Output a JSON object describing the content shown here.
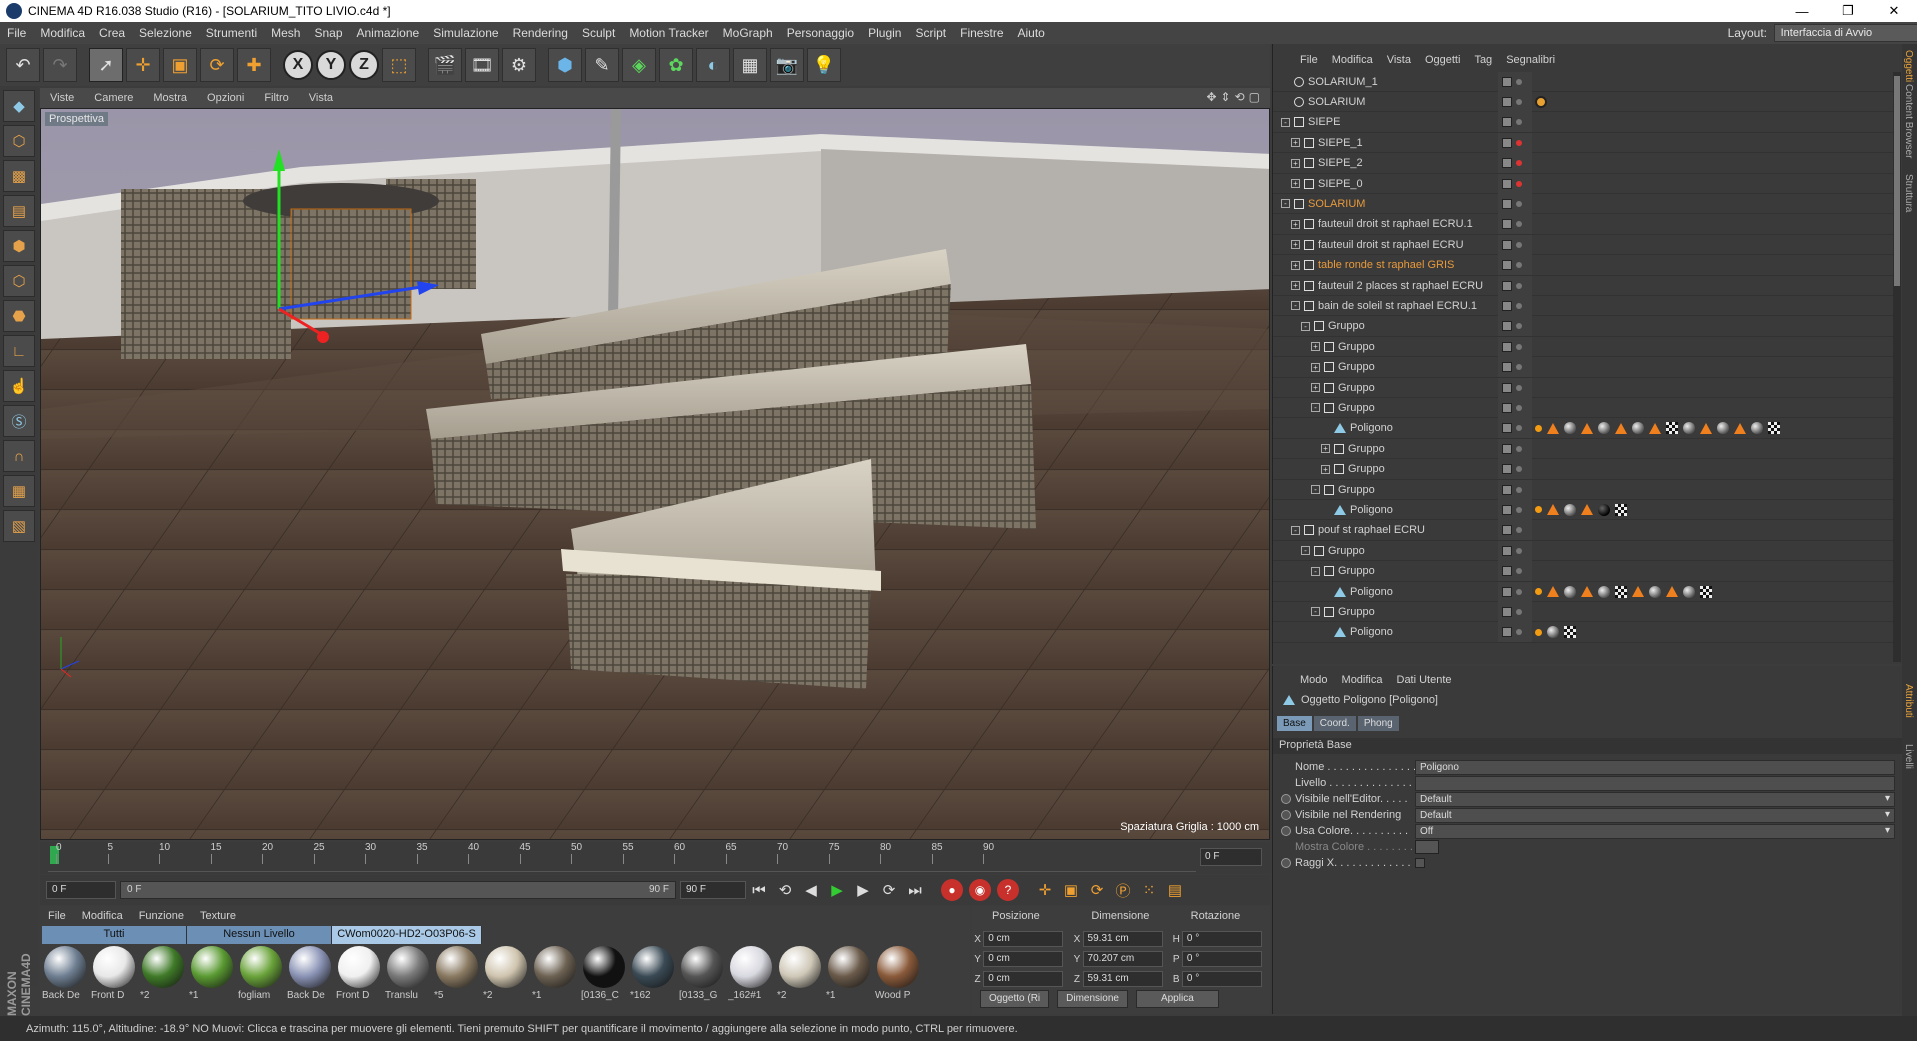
{
  "window": {
    "title": "CINEMA 4D R16.038 Studio (R16) - [SOLARIUM_TITO LIVIO.c4d *]"
  },
  "menu": {
    "items": [
      "File",
      "Modifica",
      "Crea",
      "Selezione",
      "Strumenti",
      "Mesh",
      "Snap",
      "Animazione",
      "Simulazione",
      "Rendering",
      "Sculpt",
      "Motion Tracker",
      "MoGraph",
      "Personaggio",
      "Plugin",
      "Script",
      "Finestre",
      "Aiuto"
    ],
    "layout_label": "Layout:",
    "layout_value": "Interfaccia di Avvio"
  },
  "viewport": {
    "menu": [
      "Viste",
      "Camere",
      "Mostra",
      "Opzioni",
      "Filtro",
      "Vista"
    ],
    "label": "Prospettiva",
    "grid_spacing": "Spaziatura Griglia : 1000 cm"
  },
  "timeline": {
    "ticks": [
      "0",
      "5",
      "10",
      "15",
      "20",
      "25",
      "30",
      "35",
      "40",
      "45",
      "50",
      "55",
      "60",
      "65",
      "70",
      "75",
      "80",
      "85",
      "90"
    ],
    "frame_end_field": "0 F",
    "start_field": "0 F",
    "range_start": "0 F",
    "range_end": "90 F",
    "end_field": "90 F"
  },
  "materials": {
    "menu": [
      "File",
      "Modifica",
      "Funzione",
      "Texture"
    ],
    "tabs": [
      "Tutti",
      "Nessun Livello",
      "CWom0020-HD2-O03P06-S"
    ],
    "items": [
      {
        "name": "Back De",
        "color": "#6f7f92"
      },
      {
        "name": "Front D",
        "color": "#e8e8e8"
      },
      {
        "name": "*2",
        "color": "#3f7a28"
      },
      {
        "name": "*1",
        "color": "#5a9a32"
      },
      {
        "name": "fogliam",
        "color": "#6aa33a"
      },
      {
        "name": "Back De",
        "color": "#8a93b5"
      },
      {
        "name": "Front D",
        "color": "#f0f0f0"
      },
      {
        "name": "Translu",
        "color": "#7a7a7a"
      },
      {
        "name": "*5",
        "color": "#8a7a62"
      },
      {
        "name": "*2",
        "color": "#cfc4ae"
      },
      {
        "name": "*1",
        "color": "#6d6253"
      },
      {
        "name": "[0136_C",
        "color": "#111111"
      },
      {
        "name": "*162",
        "color": "#3a4a55"
      },
      {
        "name": "[0133_G",
        "color": "#555555"
      },
      {
        "name": "_162#1",
        "color": "#d8d8e0"
      },
      {
        "name": "*2",
        "color": "#cfc8b8"
      },
      {
        "name": "*1",
        "color": "#6a5a4a"
      },
      {
        "name": "Wood P",
        "color": "#8a5a3a"
      }
    ]
  },
  "coords": {
    "headers": [
      "Posizione",
      "Dimensione",
      "Rotazione"
    ],
    "rows": [
      {
        "axis": "X",
        "pos": "0 cm",
        "dim_axis": "X",
        "dim": "59.31 cm",
        "rot_axis": "H",
        "rot": "0 °"
      },
      {
        "axis": "Y",
        "pos": "0 cm",
        "dim_axis": "Y",
        "dim": "70.207 cm",
        "rot_axis": "P",
        "rot": "0 °"
      },
      {
        "axis": "Z",
        "pos": "0 cm",
        "dim_axis": "Z",
        "dim": "59.31 cm",
        "rot_axis": "B",
        "rot": "0 °"
      }
    ],
    "btn_mode": "Oggetto (Ri",
    "btn_dim": "Dimensione",
    "btn_apply": "Applica"
  },
  "objects": {
    "menu": [
      "File",
      "Modifica",
      "Vista",
      "Oggetti",
      "Tag",
      "Segnalibri"
    ],
    "rows": [
      {
        "name": "SOLARIUM_1",
        "indent": 0,
        "type": "light",
        "exp": "",
        "color": "normal",
        "dot": "grey",
        "tags": []
      },
      {
        "name": "SOLARIUM",
        "indent": 0,
        "type": "light",
        "exp": "",
        "color": "normal",
        "dot": "grey",
        "tags": [
          "forbid"
        ]
      },
      {
        "name": "SIEPE",
        "indent": 0,
        "type": "null",
        "exp": "-",
        "color": "normal",
        "dot": "grey",
        "tags": []
      },
      {
        "name": "SIEPE_1",
        "indent": 1,
        "type": "null",
        "exp": "+",
        "color": "normal",
        "dot": "red",
        "tags": []
      },
      {
        "name": "SIEPE_2",
        "indent": 1,
        "type": "null",
        "exp": "+",
        "color": "normal",
        "dot": "red",
        "tags": []
      },
      {
        "name": "SIEPE_0",
        "indent": 1,
        "type": "null",
        "exp": "+",
        "color": "normal",
        "dot": "red",
        "tags": []
      },
      {
        "name": "SOLARIUM",
        "indent": 0,
        "type": "null",
        "exp": "-",
        "color": "orange",
        "dot": "grey",
        "tags": []
      },
      {
        "name": "fauteuil droit st raphael ECRU.1",
        "indent": 1,
        "type": "null",
        "exp": "+",
        "color": "normal",
        "dot": "grey",
        "tags": []
      },
      {
        "name": "fauteuil droit st raphael ECRU",
        "indent": 1,
        "type": "null",
        "exp": "+",
        "color": "normal",
        "dot": "grey",
        "tags": []
      },
      {
        "name": "table ronde st raphael GRIS",
        "indent": 1,
        "type": "null",
        "exp": "+",
        "color": "orange",
        "dot": "grey",
        "tags": []
      },
      {
        "name": "fauteuil 2 places st raphael ECRU",
        "indent": 1,
        "type": "null",
        "exp": "+",
        "color": "normal",
        "dot": "grey",
        "tags": []
      },
      {
        "name": "bain de soleil st raphael ECRU.1",
        "indent": 1,
        "type": "null",
        "exp": "-",
        "color": "normal",
        "dot": "grey",
        "tags": []
      },
      {
        "name": "Gruppo",
        "indent": 2,
        "type": "null",
        "exp": "-",
        "color": "normal",
        "dot": "grey",
        "tags": []
      },
      {
        "name": "Gruppo",
        "indent": 3,
        "type": "null",
        "exp": "+",
        "color": "normal",
        "dot": "grey",
        "tags": []
      },
      {
        "name": "Gruppo",
        "indent": 3,
        "type": "null",
        "exp": "+",
        "color": "normal",
        "dot": "grey",
        "tags": []
      },
      {
        "name": "Gruppo",
        "indent": 3,
        "type": "null",
        "exp": "+",
        "color": "normal",
        "dot": "grey",
        "tags": []
      },
      {
        "name": "Gruppo",
        "indent": 3,
        "type": "null",
        "exp": "-",
        "color": "normal",
        "dot": "grey",
        "tags": []
      },
      {
        "name": "Poligono",
        "indent": 4,
        "type": "poly",
        "exp": "",
        "color": "normal",
        "dot": "grey",
        "tags": [
          "dot",
          "tri",
          "sph",
          "tri",
          "sph",
          "tri",
          "sph",
          "tri",
          "chk",
          "sph",
          "tri",
          "sph",
          "tri",
          "sph",
          "chk"
        ]
      },
      {
        "name": "Gruppo",
        "indent": 4,
        "type": "null",
        "exp": "+",
        "color": "normal",
        "dot": "grey",
        "tags": []
      },
      {
        "name": "Gruppo",
        "indent": 4,
        "type": "null",
        "exp": "+",
        "color": "normal",
        "dot": "grey",
        "tags": []
      },
      {
        "name": "Gruppo",
        "indent": 3,
        "type": "null",
        "exp": "-",
        "color": "normal",
        "dot": "grey",
        "tags": []
      },
      {
        "name": "Poligono",
        "indent": 4,
        "type": "poly",
        "exp": "",
        "color": "normal",
        "dot": "grey",
        "tags": [
          "dot",
          "tri",
          "sph",
          "tri",
          "blk",
          "chk"
        ]
      },
      {
        "name": "pouf st raphael ECRU",
        "indent": 1,
        "type": "null",
        "exp": "-",
        "color": "normal",
        "dot": "grey",
        "tags": []
      },
      {
        "name": "Gruppo",
        "indent": 2,
        "type": "null",
        "exp": "-",
        "color": "normal",
        "dot": "grey",
        "tags": []
      },
      {
        "name": "Gruppo",
        "indent": 3,
        "type": "null",
        "exp": "-",
        "color": "normal",
        "dot": "grey",
        "tags": []
      },
      {
        "name": "Poligono",
        "indent": 4,
        "type": "poly",
        "exp": "",
        "color": "normal",
        "dot": "grey",
        "tags": [
          "dot",
          "tri",
          "sph",
          "tri",
          "sph",
          "chk",
          "tri",
          "sph",
          "tri",
          "sph",
          "chk"
        ]
      },
      {
        "name": "Gruppo",
        "indent": 3,
        "type": "null",
        "exp": "-",
        "color": "normal",
        "dot": "grey",
        "tags": []
      },
      {
        "name": "Poligono",
        "indent": 4,
        "type": "poly",
        "exp": "",
        "color": "normal",
        "dot": "grey",
        "tags": [
          "dot",
          "sph",
          "chk"
        ]
      }
    ]
  },
  "attributes": {
    "menu": [
      "Modo",
      "Modifica",
      "Dati Utente"
    ],
    "title": "Oggetto Poligono [Poligono]",
    "tabs": [
      "Base",
      "Coord.",
      "Phong"
    ],
    "section": "Proprietà Base",
    "rows": [
      {
        "label": "Nome . . . . . . . . . . . . . . .",
        "value": "Poligono",
        "kind": "text",
        "radio": false,
        "dim": false
      },
      {
        "label": "Livello . . . . . . . . . . . . . .",
        "value": "",
        "kind": "text",
        "radio": false,
        "dim": false
      },
      {
        "label": "Visibile nell'Editor. . . . .",
        "value": "Default",
        "kind": "dd",
        "radio": true,
        "dim": false
      },
      {
        "label": "Visibile nel Rendering",
        "value": "Default",
        "kind": "dd",
        "radio": true,
        "dim": false
      },
      {
        "label": "Usa Colore. . . . . . . . . .",
        "value": "Off",
        "kind": "dd",
        "radio": true,
        "dim": false
      },
      {
        "label": "Mostra Colore . . . . . . . .",
        "value": "",
        "kind": "swatch",
        "radio": false,
        "dim": true
      },
      {
        "label": "Raggi X. . . . . . . . . . . . .",
        "value": "",
        "kind": "check",
        "radio": true,
        "dim": false
      }
    ]
  },
  "right_tabs": [
    "Oggetti",
    "Content Browser",
    "Struttura",
    "Attributi",
    "Livelli"
  ],
  "status": "Azimuth: 115.0°, Altitudine: -18.9°  NO      Muovi: Clicca e trascina per muovere gli elementi. Tieni premuto SHIFT per quantificare il movimento / aggiungere alla selezione in modo punto, CTRL per rimuovere."
}
